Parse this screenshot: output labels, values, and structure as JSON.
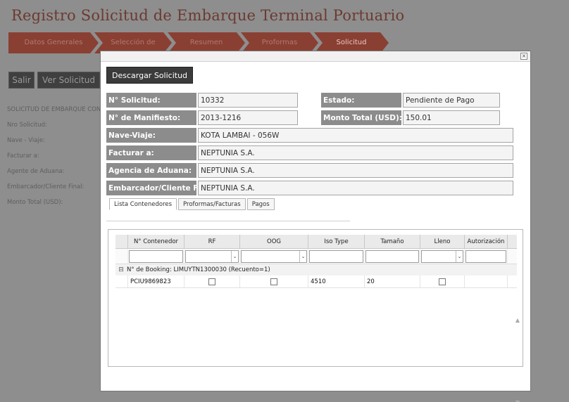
{
  "page": {
    "title": "Registro Solicitud de Embarque Terminal Portuario",
    "steps": [
      "Datos Generales",
      "Selección de",
      "Resumen",
      "Proformas",
      "Solicitud"
    ],
    "buttons": {
      "salir": "Salir",
      "ver_solicitud": "Ver Solicitud"
    },
    "side_labels": [
      "SOLICITUD DE EMBARQUE CON",
      "Nro Solicitud:",
      "Nave - Viaje:",
      "Facturar a:",
      "Agente de Aduana:",
      "Embarcador/Cliente Final:",
      "Monto Total (USD):"
    ]
  },
  "modal": {
    "close_glyph": "×",
    "download_label": "Descargar Solicitud",
    "fields": {
      "solicitud": {
        "label": "N° Solicitud:",
        "value": "10332"
      },
      "estado": {
        "label": "Estado:",
        "value": "Pendiente de Pago"
      },
      "manifiesto": {
        "label": "N° de Manifiesto:",
        "value": "2013-1216"
      },
      "monto": {
        "label": "Monto Total (USD):",
        "value": "150.01"
      },
      "nave": {
        "label": "Nave-Viaje:",
        "value": "KOTA LAMBAI - 056W"
      },
      "facturar": {
        "label": "Facturar a:",
        "value": "NEPTUNIA S.A."
      },
      "agencia": {
        "label": "Agencia de Aduana:",
        "value": "NEPTUNIA S.A."
      },
      "embarcador": {
        "label": "Embarcador/Cliente Final:",
        "value": "NEPTUNIA S.A."
      }
    },
    "tabs": [
      "Lista Contenedores",
      "Proformas/Facturas",
      "Pagos"
    ],
    "grid": {
      "columns": [
        "N° Contenedor",
        "RF",
        "OOG",
        "Iso Type",
        "Tamaño",
        "Lleno",
        "Autorización"
      ],
      "dropdown_arrow": "⌄",
      "group_toggle": "⊟",
      "group_label": "N° de Booking: LIMUYTN1300030 (Recuento=1)",
      "rows": [
        {
          "contenedor": "PCIU9869823",
          "rf": false,
          "oog": false,
          "iso_type": "4510",
          "tamano": "20",
          "lleno": false,
          "autorizacion": ""
        }
      ],
      "scroll_up": "▲",
      "scroll_down": "▼"
    }
  }
}
